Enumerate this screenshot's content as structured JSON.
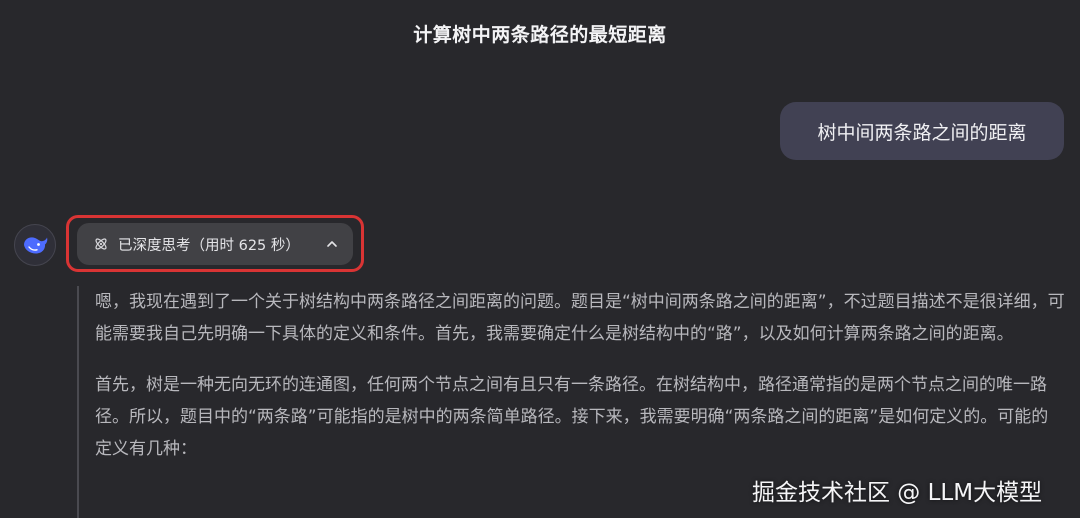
{
  "header": {
    "title": "计算树中两条路径的最短距离"
  },
  "user_message": {
    "text": "树中间两条路之间的距离"
  },
  "assistant": {
    "avatar_icon": "deepseek-whale-icon",
    "think_toggle": {
      "icon": "atom-icon",
      "label": "已深度思考（用时 625 秒）",
      "chevron": "chevron-up-icon"
    },
    "reasoning_paragraphs": [
      "嗯，我现在遇到了一个关于树结构中两条路径之间距离的问题。题目是“树中间两条路之间的距离”，不过题目描述不是很详细，可能需要我自己先明确一下具体的定义和条件。首先，我需要确定什么是树结构中的“路”，以及如何计算两条路之间的距离。",
      "首先，树是一种无向无环的连通图，任何两个节点之间有且只有一条路径。在树结构中，路径通常指的是两个节点之间的唯一路径。所以，题目中的“两条路”可能指的是树中的两条简单路径。接下来，我需要明确“两条路之间的距离”是如何定义的。可能的定义有几种："
    ]
  },
  "watermark": {
    "text": "掘金技术社区 @ LLM大模型"
  },
  "colors": {
    "background": "#28282c",
    "user_bubble": "#414153",
    "highlight_border": "#d93434",
    "toggle_bg": "#414145",
    "reasoning_text": "#b8b8bd",
    "avatar_accent": "#4d6bfe"
  }
}
